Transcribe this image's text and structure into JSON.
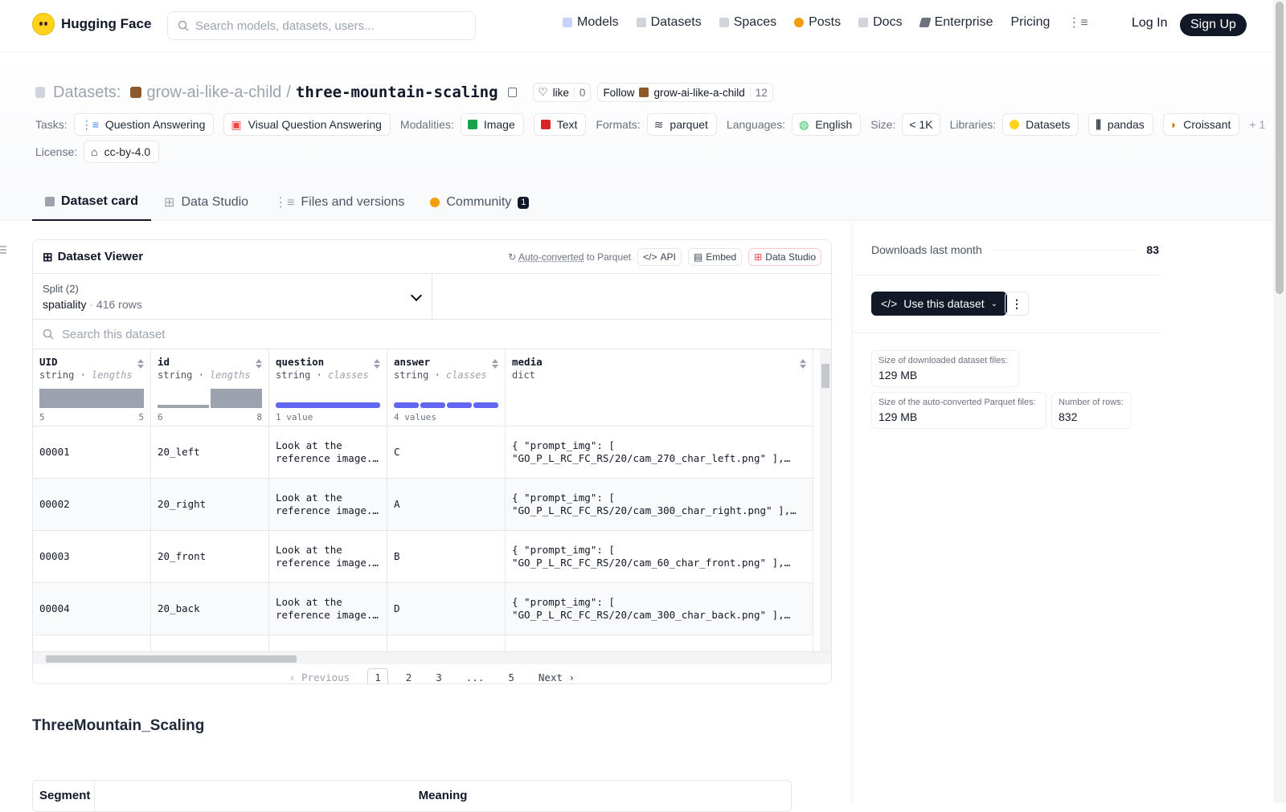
{
  "nav": {
    "brand": "Hugging Face",
    "search_placeholder": "Search models, datasets, users...",
    "links": [
      "Models",
      "Datasets",
      "Spaces",
      "Posts",
      "Docs",
      "Enterprise",
      "Pricing"
    ],
    "login": "Log In",
    "signup": "Sign Up"
  },
  "repo": {
    "prefix": "Datasets:",
    "owner": "grow-ai-like-a-child",
    "sep": "/",
    "name": "three-mountain-scaling",
    "like_label": "like",
    "like_count": "0",
    "follow_label": "Follow",
    "follow_owner": "grow-ai-like-a-child",
    "follow_count": "12"
  },
  "tags": {
    "tasks_label": "Tasks:",
    "tasks": [
      "Question Answering",
      "Visual Question Answering"
    ],
    "modalities_label": "Modalities:",
    "modalities": [
      "Image",
      "Text"
    ],
    "formats_label": "Formats:",
    "formats": [
      "parquet"
    ],
    "languages_label": "Languages:",
    "languages": [
      "English"
    ],
    "size_label": "Size:",
    "size": [
      "< 1K"
    ],
    "libraries_label": "Libraries:",
    "libraries": [
      "Datasets",
      "pandas",
      "Croissant"
    ],
    "libraries_more": "+ 1",
    "license_label": "License:",
    "license": "cc-by-4.0"
  },
  "tabs": [
    {
      "label": "Dataset card"
    },
    {
      "label": "Data Studio"
    },
    {
      "label": "Files and versions"
    },
    {
      "label": "Community",
      "badge": "1"
    }
  ],
  "viewer": {
    "title": "Dataset Viewer",
    "autoconv_link": "Auto-converted",
    "autoconv_rest": "to Parquet",
    "api": "API",
    "embed": "Embed",
    "studio": "Data Studio",
    "split_label": "Split (2)",
    "split_name": "spatiality",
    "split_rows": "416 rows",
    "search_placeholder": "Search this dataset",
    "columns": [
      {
        "name": "UID",
        "type": "string",
        "kind": "lengths",
        "min": "5",
        "max": "5"
      },
      {
        "name": "id",
        "type": "string",
        "kind": "lengths",
        "min": "6",
        "max": "8"
      },
      {
        "name": "question",
        "type": "string",
        "kind": "classes",
        "summary": "1 value"
      },
      {
        "name": "answer",
        "type": "string",
        "kind": "classes",
        "summary": "4 values"
      },
      {
        "name": "media",
        "type": "dict"
      }
    ],
    "rows": [
      {
        "uid": "00001",
        "id": "20_left",
        "question": "Look at the reference image.…",
        "answer": "C",
        "media1": "{ \"prompt_img\": [",
        "media2": "\"GO_P_L_RC_FC_RS/20/cam_270_char_left.png\" ],…"
      },
      {
        "uid": "00002",
        "id": "20_right",
        "question": "Look at the reference image.…",
        "answer": "A",
        "media1": "{ \"prompt_img\": [",
        "media2": "\"GO_P_L_RC_FC_RS/20/cam_300_char_right.png\" ],…"
      },
      {
        "uid": "00003",
        "id": "20_front",
        "question": "Look at the reference image.…",
        "answer": "B",
        "media1": "{ \"prompt_img\": [",
        "media2": "\"GO_P_L_RC_FC_RS/20/cam_60_char_front.png\" ],…"
      },
      {
        "uid": "00004",
        "id": "20_back",
        "question": "Look at the reference image.…",
        "answer": "D",
        "media1": "{ \"prompt_img\": [",
        "media2": "\"GO_P_L_RC_FC_RS/20/cam_300_char_back.png\" ],…"
      }
    ],
    "pager": {
      "prev": "Previous",
      "pages": [
        "1",
        "2",
        "3",
        "...",
        "5"
      ],
      "next": "Next",
      "current": "1"
    }
  },
  "card": {
    "title": "ThreeMountain_Scaling",
    "table_headers": [
      "Segment",
      "Meaning"
    ]
  },
  "side": {
    "downloads_label": "Downloads last month",
    "downloads": "83",
    "use_btn": "Use this dataset",
    "stats": [
      {
        "k": "Size of downloaded dataset files:",
        "v": "129 MB"
      },
      {
        "k": "Size of the auto-converted Parquet files:",
        "v": "129 MB"
      },
      {
        "k": "Number of rows:",
        "v": "832"
      }
    ]
  },
  "colors": {
    "brand_yellow": "#ffd21e",
    "dark": "#111827",
    "hist_gray": "#9ca3af",
    "class_bar": "#6366f1"
  }
}
